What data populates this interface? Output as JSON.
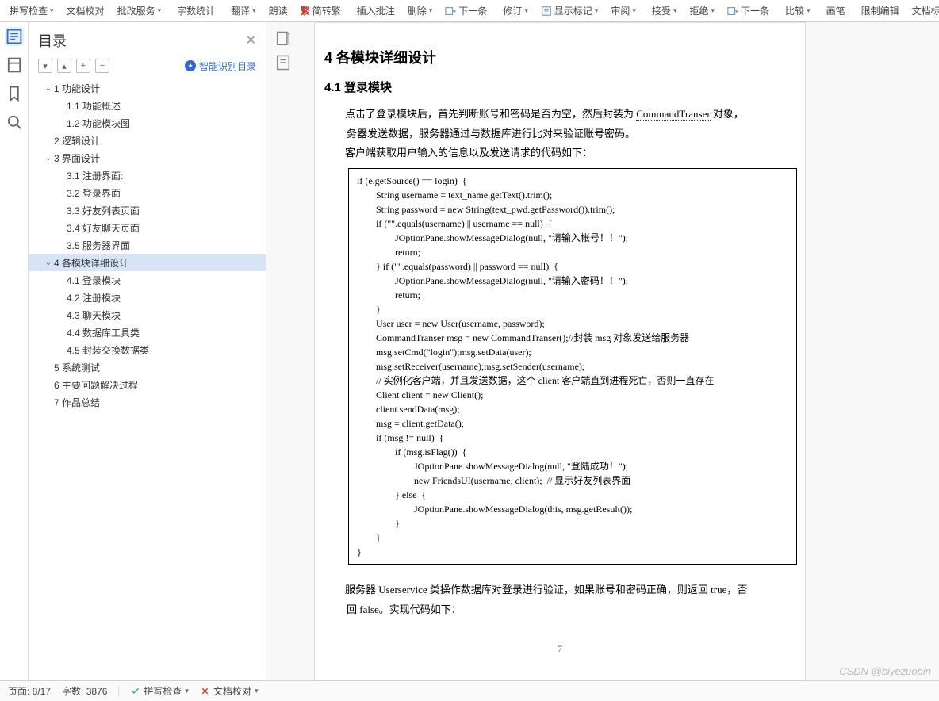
{
  "toolbar": {
    "spell_check": "拼写检查",
    "doc_proof": "文档校对",
    "batch_service": "批改服务",
    "word_count": "字数统计",
    "translate": "翻译",
    "read_aloud": "朗读",
    "simp_trad_icon": "繁",
    "simp_trad": "简转繁",
    "insert_comment": "插入批注",
    "delete": "删除",
    "prev_item": "下一条",
    "revise": "修订",
    "show_markup": "显示标记",
    "review": "审阅",
    "accept": "接受",
    "reject": "拒绝",
    "next_item": "下一条",
    "compare": "比较",
    "pen": "画笔",
    "restrict_edit": "限制编辑",
    "doc_mark": "文档标"
  },
  "outline": {
    "title": "目录",
    "auto_detect": "智能识别目录",
    "items": [
      {
        "level": 0,
        "expand": "open",
        "label": "1  功能设计"
      },
      {
        "level": 1,
        "expand": "",
        "label": "1.1 功能概述"
      },
      {
        "level": 1,
        "expand": "",
        "label": "1.2 功能模块图"
      },
      {
        "level": 0,
        "expand": "none",
        "label": "2  逻辑设计"
      },
      {
        "level": 0,
        "expand": "open",
        "label": "3  界面设计"
      },
      {
        "level": 1,
        "expand": "",
        "label": "3.1 注册界面:"
      },
      {
        "level": 1,
        "expand": "",
        "label": "3.2 登录界面"
      },
      {
        "level": 1,
        "expand": "",
        "label": "3.3 好友列表页面"
      },
      {
        "level": 1,
        "expand": "",
        "label": "3.4 好友聊天页面"
      },
      {
        "level": 1,
        "expand": "",
        "label": "3.5 服务器界面"
      },
      {
        "level": 0,
        "expand": "open",
        "label": "4  各模块详细设计",
        "selected": true
      },
      {
        "level": 1,
        "expand": "",
        "label": "4.1 登录模块"
      },
      {
        "level": 1,
        "expand": "",
        "label": "4.2 注册模块"
      },
      {
        "level": 1,
        "expand": "",
        "label": "4.3 聊天模块"
      },
      {
        "level": 1,
        "expand": "",
        "label": "4.4 数据库工具类"
      },
      {
        "level": 1,
        "expand": "",
        "label": "4.5 封装交换数据类"
      },
      {
        "level": 0,
        "expand": "none",
        "label": "5  系统测试"
      },
      {
        "level": 0,
        "expand": "none",
        "label": "6  主要问题解决过程"
      },
      {
        "level": 0,
        "expand": "none",
        "label": "7  作品总结"
      }
    ]
  },
  "doc": {
    "h1": "4  各模块详细设计",
    "h2": "4.1 登录模块",
    "para1_a": "点击了登录模块后，首先判断账号和密码是否为空，然后封装为 ",
    "para1_link": "CommandTranser",
    "para1_b": " 对象，",
    "para2": "务器发送数据，服务器通过与数据库进行比对来验证账号密码。",
    "para3": "客户端获取用户输入的信息以及发送请求的代码如下：",
    "code": "if (e.getSource() == login)  {\n        String username = text_name.getText().trim();\n        String password = new String(text_pwd.getPassword()).trim();\n        if (\"\".equals(username) || username == null)  {\n                JOptionPane.showMessageDialog(null, \"请输入帐号！！\");\n                return;\n        } if (\"\".equals(password) || password == null)  {\n                JOptionPane.showMessageDialog(null, \"请输入密码！！\");\n                return;\n        }\n        User user = new User(username, password);\n        CommandTranser msg = new CommandTranser();//封装 msg 对象发送给服务器\n        msg.setCmd(\"login\");msg.setData(user);\n        msg.setReceiver(username);msg.setSender(username);\n        // 实例化客户端，并且发送数据，这个 client 客户端直到进程死亡，否则一直存在\n        Client client = new Client();\n        client.sendData(msg);\n        msg = client.getData();\n        if (msg != null)  {\n                if (msg.isFlag())  {\n                        JOptionPane.showMessageDialog(null, \"登陆成功！\");\n                        new FriendsUI(username, client);  // 显示好友列表界面\n                } else  {\n                        JOptionPane.showMessageDialog(this, msg.getResult());\n                }\n        }\n}",
    "para4_a": "服务器 ",
    "para4_link": "Userservice",
    "para4_b": " 类操作数据库对登录进行验证，如果账号和密码正确，则返回 true，否",
    "para5": "回 false。实现代码如下：",
    "page_num": "7"
  },
  "status": {
    "page": "页面: 8/17",
    "words": "字数: 3876",
    "spell": "拼写检查",
    "proof": "文档校对"
  },
  "watermark": "CSDN @biyezuopin"
}
